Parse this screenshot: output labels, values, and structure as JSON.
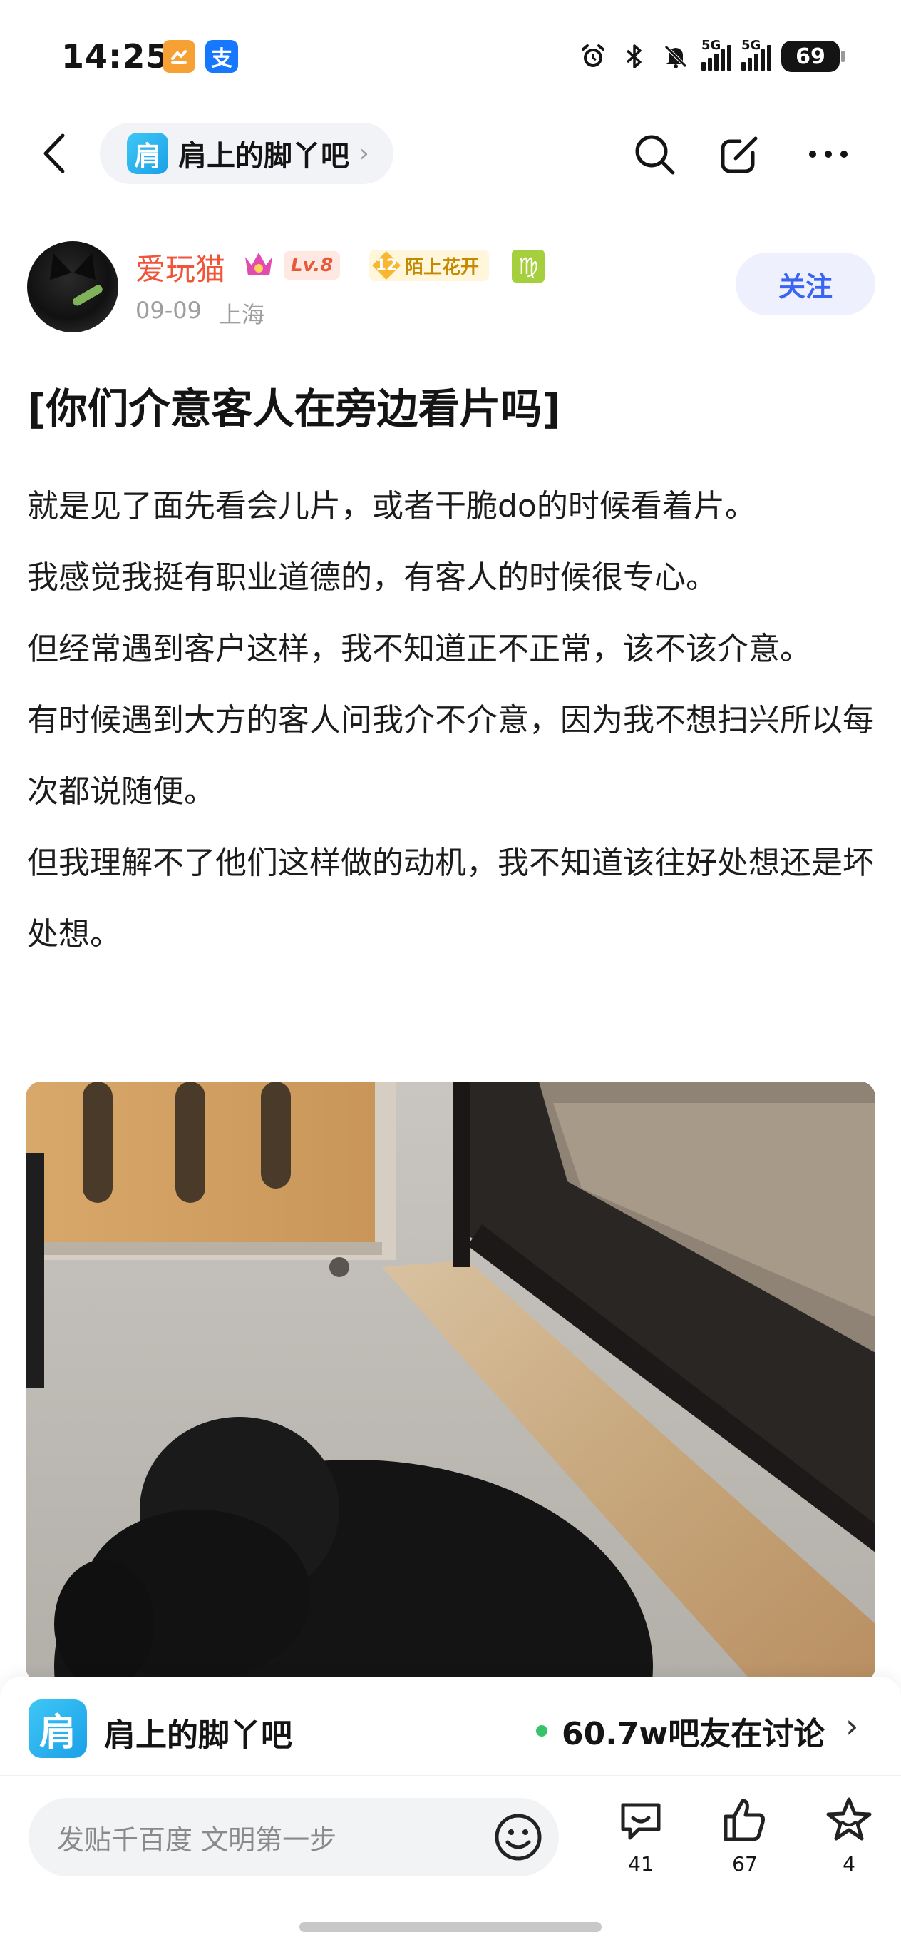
{
  "status_bar": {
    "time": "14:25",
    "app_badge_1": "",
    "app_badge_2": "支",
    "network_1": "5G",
    "network_2": "5G",
    "battery": "69"
  },
  "nav": {
    "forum_logo_char": "肩",
    "forum_name": "肩上的脚丫吧",
    "chevron": "›"
  },
  "author": {
    "name": "爱玩猫",
    "level": "Lv.8",
    "honor_num": "12",
    "honor_title": "陌上花开",
    "zodiac": "♍",
    "date": "09-09",
    "location": "上海",
    "follow_label": "关注"
  },
  "post": {
    "title": "[你们介意客人在旁边看片吗]",
    "paragraphs": [
      "就是见了面先看会儿片，或者干脆do的时候看着片。",
      "我感觉我挺有职业道德的，有客人的时候很专心。",
      "但经常遇到客户这样，我不知道正不正常，该不该介意。",
      "有时候遇到大方的客人问我介不介意，因为我不想扫兴所以每次都说随便。",
      "但我理解不了他们这样做的动机，我不知道该往好处想还是坏处想。"
    ]
  },
  "forum_bar": {
    "logo_char": "肩",
    "name": "肩上的脚丫吧",
    "online": "60.7w吧友在讨论",
    "chevron": "›"
  },
  "bottom_bar": {
    "placeholder": "发贴千百度 文明第一步",
    "comments": "41",
    "likes": "67",
    "stars": "4"
  },
  "colors": {
    "accent_blue": "#3a64f2",
    "author_name": "#f0553a",
    "online_dot": "#35c46a"
  },
  "icons": [
    "back-arrow-icon",
    "search-icon",
    "edit-icon",
    "more-icon",
    "crown-icon",
    "emoji-icon",
    "comment-icon",
    "like-icon",
    "star-icon"
  ]
}
